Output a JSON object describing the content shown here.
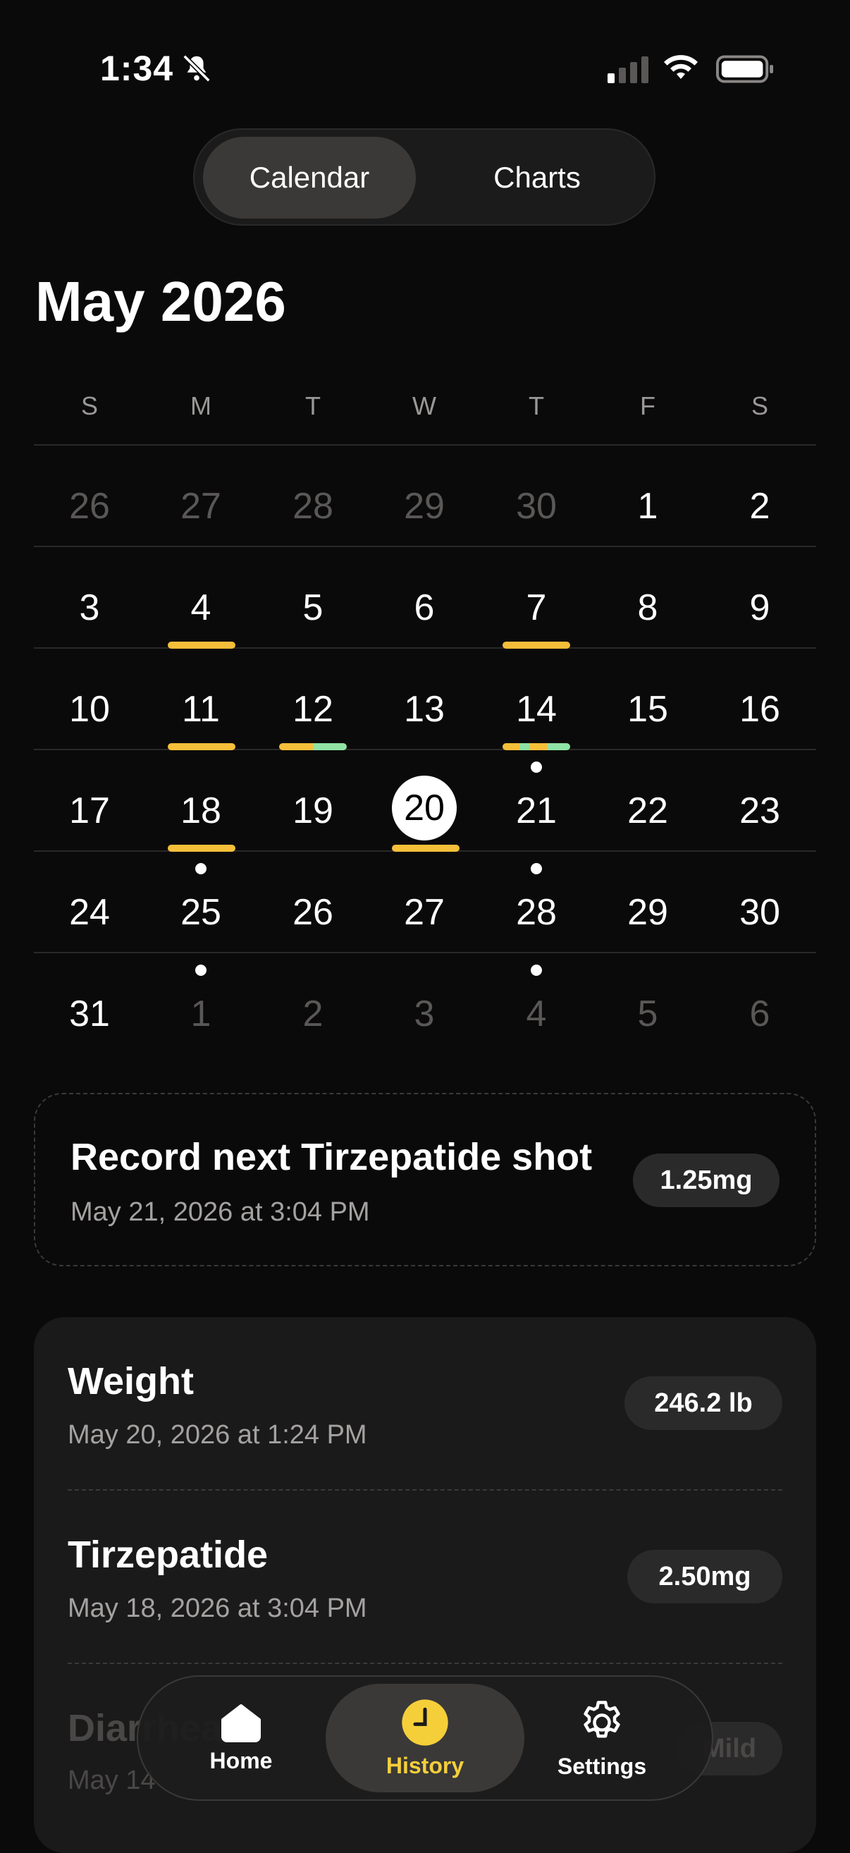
{
  "status_bar": {
    "time": "1:34"
  },
  "segment": {
    "active": "Calendar",
    "inactive": "Charts"
  },
  "month_title": "May 2026",
  "weekdays": [
    "S",
    "M",
    "T",
    "W",
    "T",
    "F",
    "S"
  ],
  "weeks": [
    [
      "26",
      "27",
      "28",
      "29",
      "30",
      "1",
      "2"
    ],
    [
      "3",
      "4",
      "5",
      "6",
      "7",
      "8",
      "9"
    ],
    [
      "10",
      "11",
      "12",
      "13",
      "14",
      "15",
      "16"
    ],
    [
      "17",
      "18",
      "19",
      "20",
      "21",
      "22",
      "23"
    ],
    [
      "24",
      "25",
      "26",
      "27",
      "28",
      "29",
      "30"
    ],
    [
      "31",
      "1",
      "2",
      "3",
      "4",
      "5",
      "6"
    ]
  ],
  "colors": {
    "accent": "#f5bf3a",
    "green": "#8fe3a4",
    "background": "#0b0a0a",
    "card": "#1b1a1a"
  },
  "next_shot": {
    "title": "Record next Tirzepatide shot",
    "subtitle": "May 21, 2026 at 3:04 PM",
    "dose": "1.25mg"
  },
  "log": [
    {
      "title": "Weight",
      "subtitle": "May 20, 2026 at 1:24 PM",
      "value": "246.2 lb"
    },
    {
      "title": "Tirzepatide",
      "subtitle": "May 18, 2026 at 3:04 PM",
      "value": "2.50mg"
    },
    {
      "title": "Diarrhea",
      "subtitle": "May 14",
      "value": "Mild"
    }
  ],
  "tabs": [
    {
      "label": "Home",
      "icon": "home-icon"
    },
    {
      "label": "History",
      "icon": "clock-icon"
    },
    {
      "label": "Settings",
      "icon": "gear-icon"
    }
  ]
}
